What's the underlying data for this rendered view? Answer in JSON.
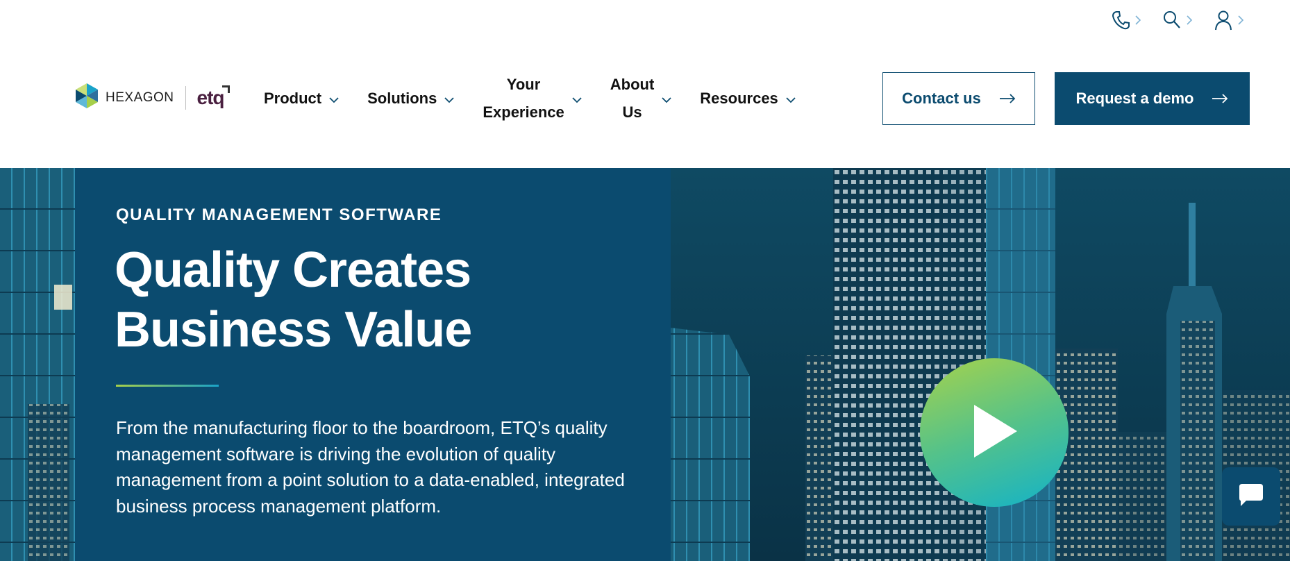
{
  "utility_bar": {
    "icons": [
      "phone-icon",
      "search-icon",
      "user-icon"
    ]
  },
  "brand": {
    "parent_name": "HEXAGON",
    "product_logo_text": "etq"
  },
  "nav": {
    "items": [
      {
        "label": "Product"
      },
      {
        "label": "Solutions"
      },
      {
        "label_line1": "Your",
        "label_line2": "Experience"
      },
      {
        "label_line1": "About",
        "label_line2": "Us"
      },
      {
        "label": "Resources"
      }
    ],
    "contact_label": "Contact us",
    "demo_label": "Request a demo"
  },
  "hero": {
    "eyebrow": "QUALITY MANAGEMENT SOFTWARE",
    "headline_line1": "Quality Creates",
    "headline_line2": "Business Value",
    "body": "From the manufacturing floor to the boardroom, ETQ’s quality management software is driving the evolution of quality management from a point solution to a data-enabled, integrated business process management platform."
  },
  "colors": {
    "brand_navy": "#0b4b6f",
    "accent_green": "#a6cf4a",
    "accent_teal": "#12b2c9",
    "etq_magenta": "#c4124e"
  }
}
